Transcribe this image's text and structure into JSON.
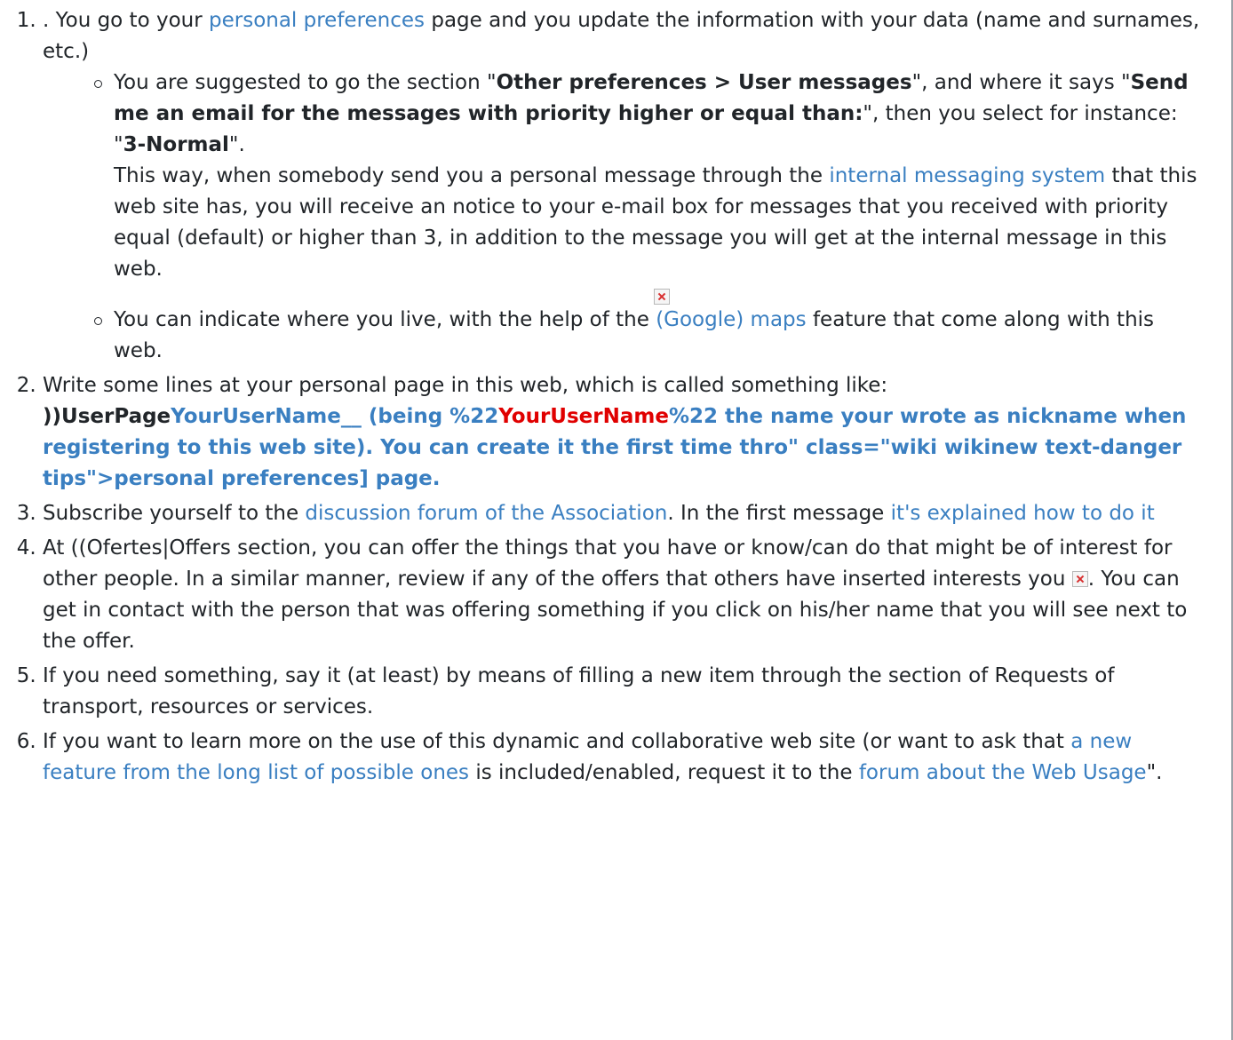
{
  "items": {
    "i1": {
      "t1": ". You go to your ",
      "link1": "personal preferences",
      "t2": " page and you update the information with your data (name and surnames, etc.)",
      "sub1": {
        "t1": "You are suggested to go the section \"",
        "b1": "Other preferences > User messages",
        "t2": "\", and where it says \"",
        "b2": "Send me an email for the messages with priority higher or equal than:",
        "t3": "\", then you select for instance: \"",
        "b3": "3-Normal",
        "t4": "\".",
        "t5": "This way, when somebody send you a personal message through the ",
        "link1": "internal messaging system",
        "t6": " that this web site has, you will receive an notice to your e-mail box for messages that you received with priority equal (default) or higher than 3, in addition to the message you will get at the internal message in this web."
      },
      "sub2": {
        "t1": "You can indicate where you live, with the help of the ",
        "link1": "(Google) maps",
        "t2": " feature that come along with this web."
      }
    },
    "i2": {
      "t1": "Write some lines at your personal page in this web, which is called something like: ",
      "b1": "))UserPage",
      "l1": "YourUserName__ (being %22",
      "red1": "YourUserName",
      "l2": "%22 the name your wrote as nickname when registering to this web site). You can create it the first time thro\" class=\"wiki wikinew text-danger tips\">personal preferences] page."
    },
    "i3": {
      "t1": "Subscribe yourself to the ",
      "link1": "discussion forum of the Association",
      "t2": ". In the first message ",
      "link2": "it's explained how to do it"
    },
    "i4": {
      "t1": "At ((Ofertes|Offers section, you can offer the things that you have or know/can do that might be of interest for other people. In a similar manner, review if any of the offers that others have inserted interests you ",
      "t2": ". You can get in contact with the person that was offering something if you click on his/her name that you will see next to the offer."
    },
    "i5": {
      "t1": "If you need something, say it (at least) by means of filling a new item through the section of Requests of transport, resources or services."
    },
    "i6": {
      "t1": "If you want to learn more on the use of this dynamic and collaborative web site (or want to ask that ",
      "link1": "a new feature from the long list of possible ones",
      "t2": " is included/enabled, request it to the ",
      "link2": "forum about the Web Usage",
      "t3": "\"."
    }
  }
}
